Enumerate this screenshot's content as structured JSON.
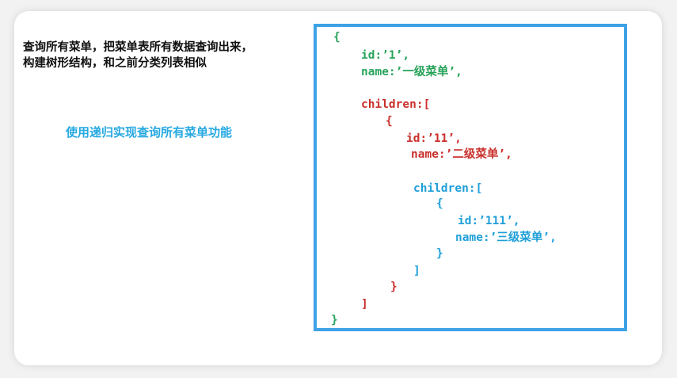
{
  "description": "查询所有菜单，把菜单表所有数据查询出来，\n构建树形结构，和之前分类列表相似",
  "caption": "使用递归实现查询所有菜单功能",
  "colors": {
    "level1": "#27a35a",
    "level2": "#c9302c",
    "level3": "#1f9fd8",
    "box_border": "#3ea2e6"
  },
  "code": {
    "open_brace_1": "{",
    "id_1": "id:’1’,",
    "name_1": "name:’一级菜单’,",
    "children_1": "children:[",
    "open_brace_2": "{",
    "id_2": "id:’11’,",
    "name_2": "name:’二级菜单’,",
    "children_2": "children:[",
    "open_brace_3": "{",
    "id_3": "id:’111’,",
    "name_3": "name:’三级菜单’,",
    "close_brace_3": "}",
    "close_bracket_2": "]",
    "close_brace_2": "}",
    "close_bracket_1": "]",
    "close_brace_1": "}"
  }
}
